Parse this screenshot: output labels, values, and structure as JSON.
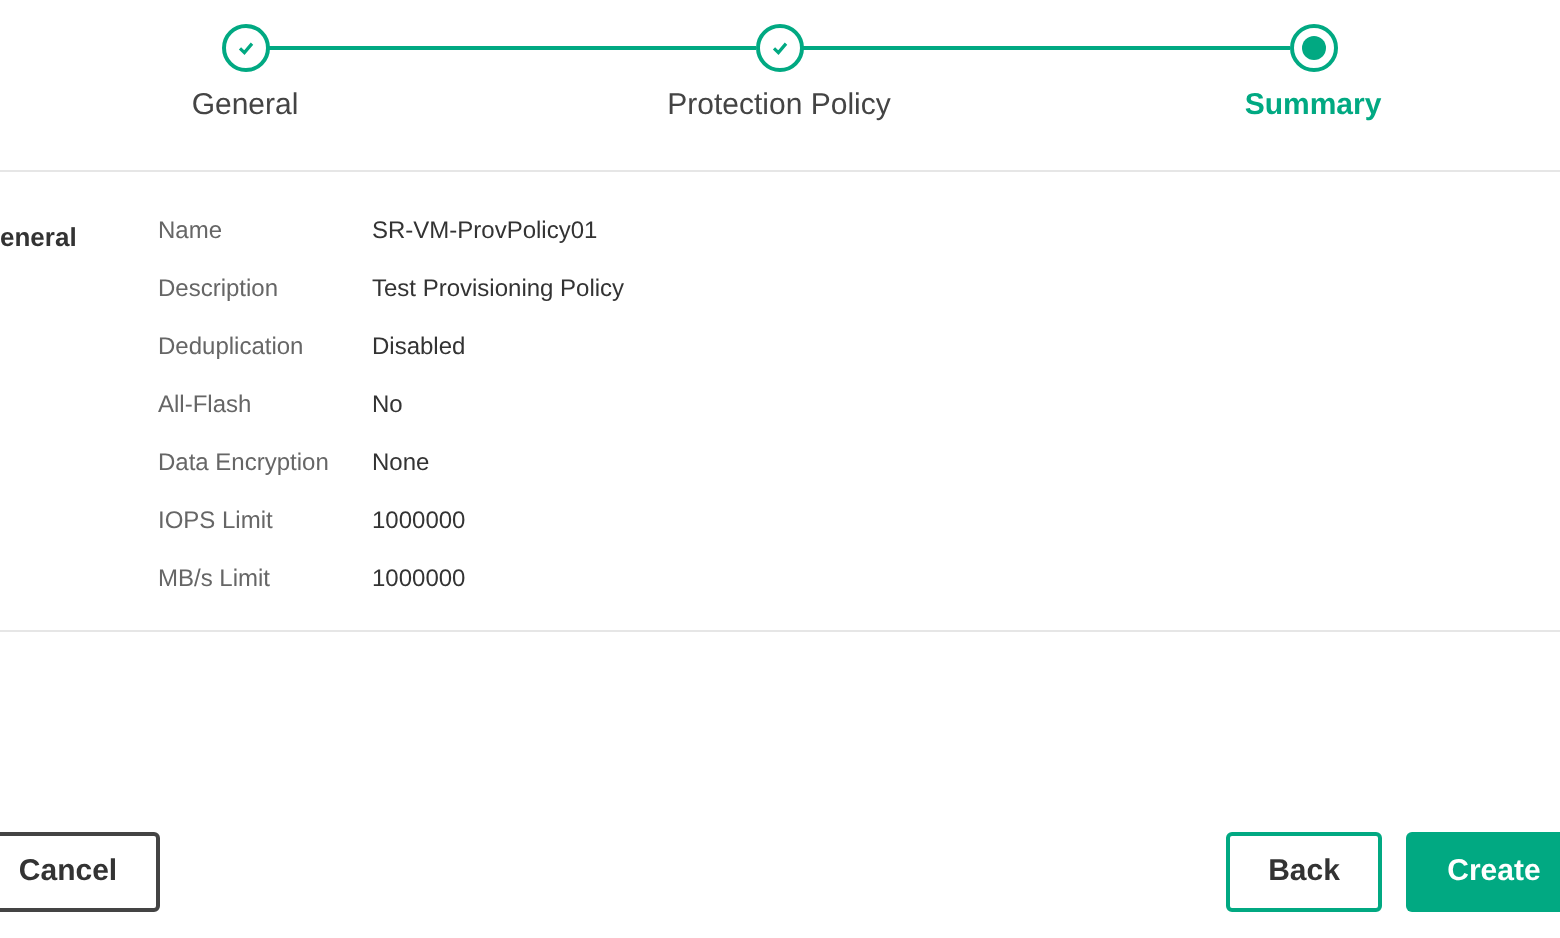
{
  "steps": [
    {
      "label": "General",
      "completed": true,
      "selected": false
    },
    {
      "label": "Protection Policy",
      "completed": true,
      "selected": false
    },
    {
      "label": "Summary",
      "completed": false,
      "selected": true
    }
  ],
  "section": {
    "title": "eneral",
    "rows": [
      {
        "label": "Name",
        "value": "SR-VM-ProvPolicy01"
      },
      {
        "label": "Description",
        "value": "Test Provisioning Policy"
      },
      {
        "label": "Deduplication",
        "value": "Disabled"
      },
      {
        "label": "All-Flash",
        "value": "No"
      },
      {
        "label": "Data Encryption",
        "value": "None"
      },
      {
        "label": "IOPS Limit",
        "value": "1000000"
      },
      {
        "label": "MB/s Limit",
        "value": "1000000"
      }
    ]
  },
  "buttons": {
    "cancel": "Cancel",
    "back": "Back",
    "create": "Create"
  }
}
